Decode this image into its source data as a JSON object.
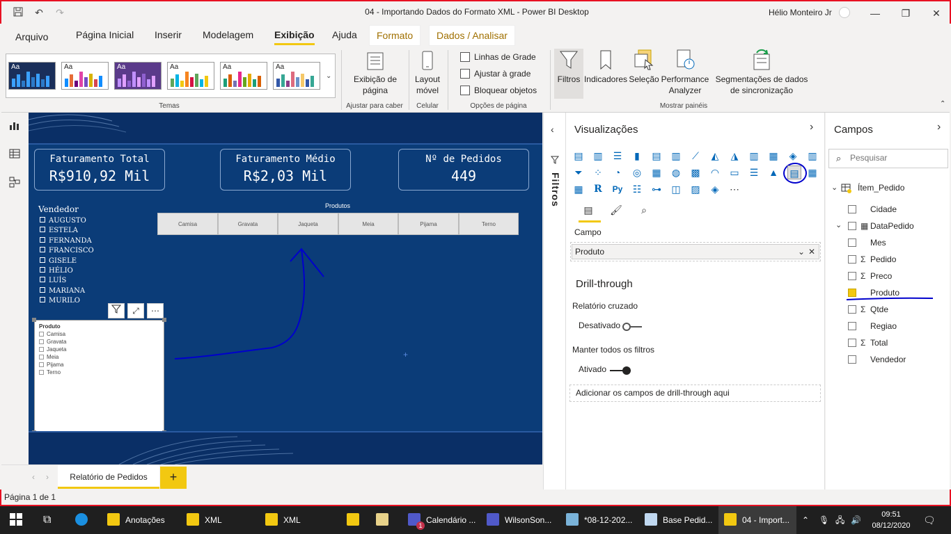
{
  "window": {
    "title": "04 - Importando Dados do Formato XML - Power BI Desktop",
    "user": "Hélio Monteiro Jr"
  },
  "menu": {
    "tabs": [
      "Arquivo",
      "Página Inicial",
      "Inserir",
      "Modelagem",
      "Exibição",
      "Ajuda",
      "Formato",
      "Dados / Analisar"
    ]
  },
  "ribbon": {
    "themes_label": "Temas",
    "theme_aa": "Aa",
    "exibicao_pagina": "Exibição de página",
    "ajustar_label": "Ajustar para caber",
    "layout_movel": "Layout móvel",
    "celular_label": "Celular",
    "linhas_grade": "Linhas de Grade",
    "ajustar_grade": "Ajustar à grade",
    "bloquear_objetos": "Bloquear objetos",
    "opcoes_pagina": "Opções de página",
    "filtros": "Filtros",
    "indicadores": "Indicadores",
    "selecao": "Seleção",
    "performance": "Performance Analyzer",
    "segmentacoes": "Segmentações de dados de sincronização",
    "mostrar_paineis": "Mostrar painéis"
  },
  "report": {
    "kpis": [
      {
        "title": "Faturamento Total",
        "value": "R$910,92 Mil"
      },
      {
        "title": "Faturamento Médio",
        "value": "R$2,03 Mil"
      },
      {
        "title": "Nº de Pedidos",
        "value": "449"
      }
    ],
    "vendedor_title": "Vendedor",
    "vendedores": [
      "AUGUSTO",
      "ESTELA",
      "FERNANDA",
      "FRANCISCO",
      "GISELE",
      "HÉLIO",
      "LUÍS",
      "MARIANA",
      "MURILO"
    ],
    "produtos_title": "Produtos",
    "produtos_tiles": [
      "Camisa",
      "Gravata",
      "Jaqueta",
      "Meia",
      "Pijama",
      "Terno"
    ],
    "slicer_title": "Produto",
    "slicer_items": [
      "Camisa",
      "Gravata",
      "Jaqueta",
      "Meia",
      "Pijama",
      "Terno"
    ]
  },
  "filters_panel": {
    "label": "Filtros"
  },
  "viz_panel": {
    "title": "Visualizações",
    "campo_label": "Campo",
    "campo_value": "Produto",
    "drill_title": "Drill-through",
    "relatorio_cruzado": "Relatório cruzado",
    "desativado": "Desativado",
    "manter_filtros": "Manter todos os filtros",
    "ativado": "Ativado",
    "drill_placeholder": "Adicionar os campos de drill-through aqui",
    "icon_r": "R",
    "icon_py": "Py"
  },
  "fields_panel": {
    "title": "Campos",
    "search_placeholder": "Pesquisar",
    "table_name": "Ítem_Pedido",
    "fields": [
      {
        "name": "Cidade",
        "sigma": false,
        "checked": false
      },
      {
        "name": "DataPedido",
        "sigma": false,
        "checked": false
      },
      {
        "name": "Mes",
        "sigma": false,
        "checked": false
      },
      {
        "name": "Pedido",
        "sigma": true,
        "checked": false
      },
      {
        "name": "Preco",
        "sigma": true,
        "checked": false
      },
      {
        "name": "Produto",
        "sigma": false,
        "checked": true
      },
      {
        "name": "Qtde",
        "sigma": true,
        "checked": false
      },
      {
        "name": "Regiao",
        "sigma": false,
        "checked": false
      },
      {
        "name": "Total",
        "sigma": true,
        "checked": false
      },
      {
        "name": "Vendedor",
        "sigma": false,
        "checked": false
      }
    ]
  },
  "pages": {
    "tab": "Relatório de Pedidos",
    "add": "+"
  },
  "status": {
    "text": "Página 1 de 1"
  },
  "taskbar": {
    "items": [
      "Anotações",
      "XML",
      "XML",
      "Calendário ...",
      "WilsonSon...",
      "*08-12-202...",
      "Base Pedid...",
      "04 - Import..."
    ],
    "time": "09:51",
    "date": "08/12/2020",
    "teams_badge": "1"
  },
  "colors": {
    "accent": "#f2c811",
    "canvas": "#0b3c78",
    "annotation": "#0000cc"
  }
}
